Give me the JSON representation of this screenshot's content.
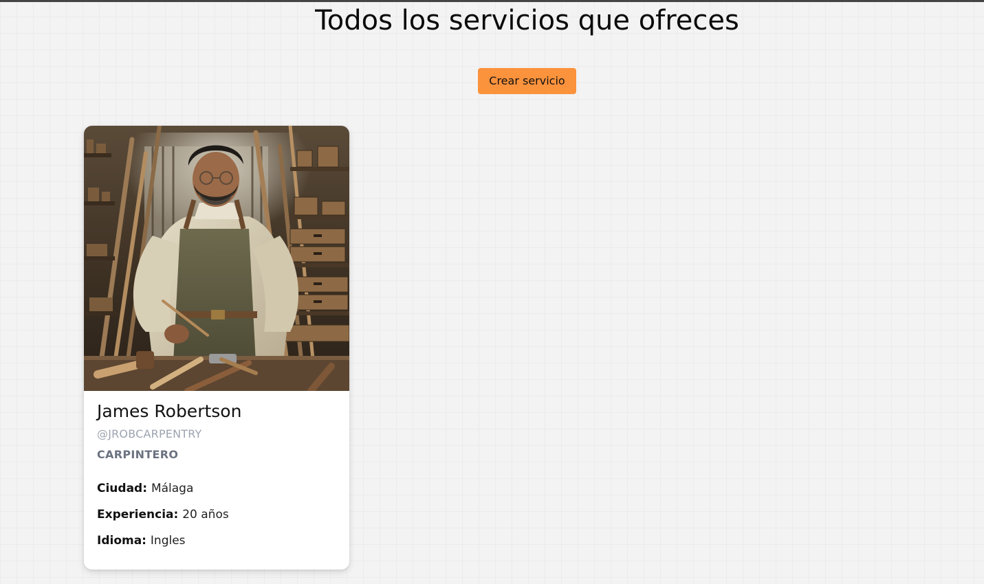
{
  "page": {
    "title": "Todos los servicios que ofreces"
  },
  "actions": {
    "create_label": "Crear servicio",
    "create_color": "#fb923c"
  },
  "services": [
    {
      "photo_icon": "carpenter-portrait-photo",
      "name": "James Robertson",
      "handle": "@JROBCARPENTRY",
      "profession": "CARPINTERO",
      "details": [
        {
          "label": "Ciudad:",
          "value": "Málaga"
        },
        {
          "label": "Experiencia:",
          "value": "20 años"
        },
        {
          "label": "Idioma:",
          "value": "Ingles"
        }
      ]
    }
  ]
}
